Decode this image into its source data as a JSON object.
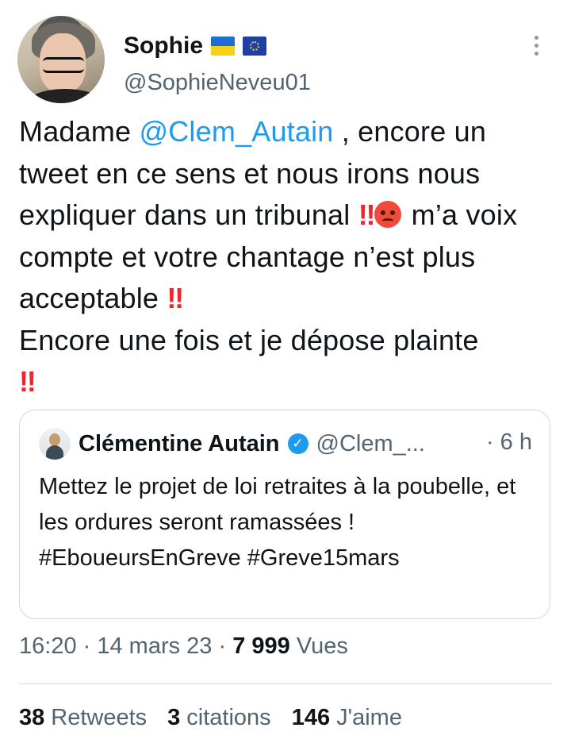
{
  "author": {
    "name": "Sophie",
    "handle": "@SophieNeveu01",
    "flags": [
      "ukraine-flag",
      "eu-flag"
    ]
  },
  "tweet": {
    "part1": "Madame ",
    "mention": "@Clem_Autain",
    "part2": " , encore un tweet en ce sens et nous irons nous expliquer dans un tribunal ",
    "bang1": "‼",
    "emoji": "angry-face",
    "part3": " m’a voix compte et votre chantage n’est plus acceptable ",
    "bang2": "‼",
    "part4": "Encore une fois et je dépose plainte",
    "bang3": "‼"
  },
  "quoted": {
    "name": "Clémentine Autain",
    "handle": "@Clem_...",
    "time": "· 6 h",
    "text": "Mettez le projet de loi retraites à la poubelle, et les ordures seront ramassées ! #EboueursEnGreve #Greve15mars"
  },
  "meta": {
    "time": "16:20",
    "sep1": " · ",
    "date": "14 mars 23",
    "sep2": " · ",
    "views_count": "7 999",
    "views_label": " Vues"
  },
  "stats": {
    "retweets_count": "38",
    "retweets_label": "Retweets",
    "quotes_count": "3",
    "quotes_label": "citations",
    "likes_count": "146",
    "likes_label": "J'aime"
  },
  "colors": {
    "mention": "#1d9bf0",
    "secondary_text": "#536471",
    "border": "#cfd9de",
    "exclamation": "#f4212e"
  }
}
